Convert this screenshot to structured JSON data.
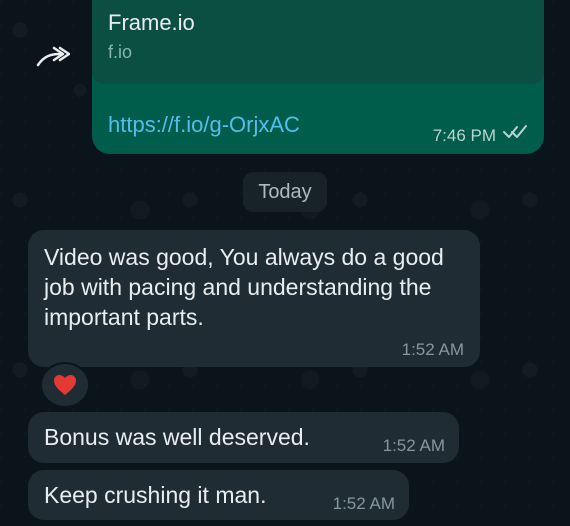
{
  "chat": {
    "link_card": {
      "preview_title": "Frame.io",
      "preview_domain": "f.io",
      "message_link": "https://f.io/g-OrjxAC",
      "time": "7:46 PM"
    },
    "date_chip": "Today",
    "messages": [
      {
        "text": "Video was good, You always do a good job with pacing and understanding the important parts.",
        "time": "1:52 AM"
      },
      {
        "text": "Bonus was well deserved.",
        "time": "1:52 AM"
      },
      {
        "text": "Keep crushing it man.",
        "time": "1:52 AM"
      }
    ],
    "reaction": "heart"
  },
  "colors": {
    "background": "#0b141a",
    "outgoing_bubble": "#005c4b",
    "incoming_bubble": "#202c33",
    "link": "#53bdeb",
    "reaction": "#e53935"
  }
}
